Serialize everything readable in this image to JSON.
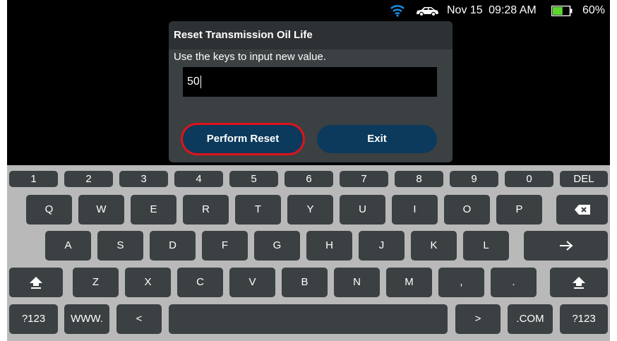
{
  "status": {
    "date": "Nov 15",
    "time": "09:28 AM",
    "battery": "60%",
    "battery_fill": 0.6
  },
  "dialog": {
    "title": "Reset Transmission Oil Life",
    "message": "Use the keys to input new value.",
    "input_value": "50",
    "perform_label": "Perform Reset",
    "exit_label": "Exit"
  },
  "keyboard": {
    "row1": [
      "1",
      "2",
      "3",
      "4",
      "5",
      "6",
      "7",
      "8",
      "9",
      "0",
      "DEL"
    ],
    "row2": [
      "Q",
      "W",
      "E",
      "R",
      "T",
      "Y",
      "U",
      "I",
      "O",
      "P"
    ],
    "row3": [
      "A",
      "S",
      "D",
      "F",
      "G",
      "H",
      "J",
      "K",
      "L"
    ],
    "row4": [
      "Z",
      "X",
      "C",
      "V",
      "B",
      "N",
      "M",
      ",",
      "."
    ],
    "row5": {
      "sym_left": "?123",
      "www": "WWW.",
      "less": "<",
      "greater": ">",
      "com": ".COM",
      "sym_right": "?123"
    }
  },
  "colors": {
    "button": "#0b3a5c",
    "highlight": "#e0121b",
    "wifi": "#1a8ce0",
    "battery": "#5dd62c"
  }
}
